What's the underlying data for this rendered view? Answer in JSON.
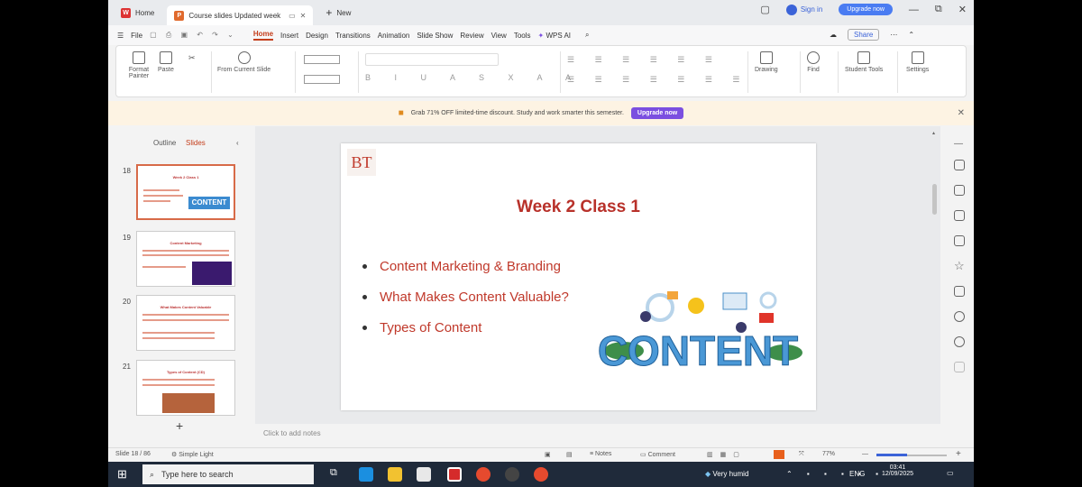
{
  "tabs": [
    {
      "label": "Home",
      "icon": "wps-logo-icon"
    },
    {
      "label": "Course slides Updated week",
      "icon": "presentation-file-icon"
    },
    {
      "label": "New",
      "icon": "plus-icon"
    }
  ],
  "window": {
    "sign_in": "Sign in",
    "upgrade": "Upgrade now"
  },
  "menu": {
    "file": "File",
    "items": [
      "Home",
      "Insert",
      "Design",
      "Transitions",
      "Animation",
      "Slide Show",
      "Review",
      "View",
      "Tools",
      "WPS AI"
    ],
    "active": "Home",
    "share": "Share"
  },
  "ribbon": {
    "format_painter": "Format Painter",
    "paste": "Paste",
    "from_current_slide": "From Current Slide",
    "drawing": "Drawing",
    "find": "Find",
    "student_tools": "Student Tools",
    "settings": "Settings"
  },
  "banner": {
    "text": "Grab 71% OFF limited-time discount. Study and work smarter this semester.",
    "button": "Upgrade now"
  },
  "pane": {
    "outline": "Outline",
    "slides": "Slides",
    "thumbs": [
      {
        "num": "18",
        "title": "Week 2 Class 1"
      },
      {
        "num": "19",
        "title": "Content Marketing"
      },
      {
        "num": "20",
        "title": "What Makes Content Valuable"
      },
      {
        "num": "21",
        "title": "Types of Content (CD)"
      }
    ],
    "add": "+"
  },
  "slide": {
    "logo": "BT",
    "title": "Week 2 Class 1",
    "bullets": [
      "Content Marketing & Branding",
      "What Makes Content Valuable?",
      "Types of Content"
    ],
    "art_word": "CONTENT"
  },
  "notes_placeholder": "Click to add notes",
  "status": {
    "slide_count": "Slide 18 / 86",
    "theme": "Simple Light",
    "notes": "Notes",
    "comment": "Comment",
    "zoom": "77%"
  },
  "taskbar": {
    "search": "Type here to search",
    "weather": "Very humid",
    "lang": "ENG",
    "time": "03:41",
    "date": "12/09/2025"
  },
  "colors": {
    "accent": "#c43e1c",
    "slide_text": "#c0392b",
    "upgrade": "#4a7cf2",
    "banner_button": "#7b4fe0"
  }
}
